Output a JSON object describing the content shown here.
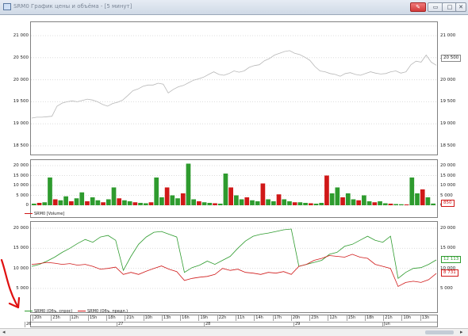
{
  "window": {
    "title": "SRM0 График цены и объёма - [5 минут]",
    "buttons": [
      "pin",
      "minimize",
      "maximize",
      "close"
    ]
  },
  "price_panel": {
    "y_ticks": [
      "21 000",
      "20 500",
      "20 000",
      "19 500",
      "19 000",
      "18 500"
    ],
    "last_tag": "20 500",
    "line_color": "#b8b8b8"
  },
  "volume_panel": {
    "y_ticks": [
      "20 000",
      "15 000",
      "10 000",
      "5 000",
      "0"
    ],
    "last_tag": "850",
    "legend": "SRM0 [Volume]",
    "colors": {
      "up": "#2e9b2e",
      "down": "#d01818"
    }
  },
  "orderbook_panel": {
    "y_ticks": [
      "20 000",
      "15 000",
      "10 000",
      "5 000"
    ],
    "tag_green": "12 113",
    "tag_red": "8 731",
    "legend_bid": "SRM0 (Объ. спрос)",
    "legend_ask": "SRM0 (Объ. предл.)",
    "colors": {
      "bid": "#2e9b2e",
      "ask": "#d01818"
    }
  },
  "x_axis": {
    "hours": [
      "20h",
      "23h",
      "12h",
      "15h",
      "18h",
      "21h",
      "10h",
      "13h",
      "16h",
      "19h",
      "22h",
      "11h",
      "14h",
      "17h",
      "20h",
      "23h",
      "12h",
      "15h",
      "18h",
      "21h",
      "10h",
      "13h"
    ],
    "days": [
      "26",
      "27",
      "28",
      "29",
      "Jun"
    ]
  },
  "annotation": {
    "arrow_color": "#e01010"
  },
  "chart_data": [
    {
      "type": "line",
      "title": "",
      "ylim": [
        18350,
        21150
      ],
      "series": [
        {
          "values": [
            19130,
            19150,
            19150,
            19160,
            19170,
            19400,
            19470,
            19500,
            19520,
            19500,
            19530,
            19560,
            19540,
            19500,
            19440,
            19400,
            19460,
            19490,
            19540,
            19640,
            19750,
            19790,
            19850,
            19880,
            19880,
            19920,
            19900,
            19700,
            19780,
            19840,
            19870,
            19930,
            19990,
            20020,
            20060,
            20120,
            20180,
            20120,
            20100,
            20140,
            20200,
            20170,
            20200,
            20280,
            20320,
            20340,
            20430,
            20480,
            20560,
            20600,
            20640,
            20660,
            20600,
            20570,
            20510,
            20440,
            20300,
            20200,
            20180,
            20140,
            20120,
            20080,
            20140,
            20160,
            20120,
            20100,
            20140,
            20180,
            20150,
            20130,
            20140,
            20180,
            20200,
            20150,
            20180,
            20340,
            20420,
            20400,
            20560,
            20400,
            20330
          ]
        }
      ]
    },
    {
      "type": "bar",
      "title": "",
      "ylim": [
        0,
        21000
      ],
      "series": [
        {
          "name": "SRM0 [Volume]",
          "values": [
            800,
            1200,
            1500,
            14000,
            3000,
            2500,
            4500,
            2000,
            3500,
            6500,
            2000,
            4000,
            2500,
            1500,
            3000,
            9000,
            3500,
            2500,
            2000,
            1500,
            1200,
            1000,
            1500,
            14000,
            4000,
            9000,
            5000,
            3500,
            6000,
            21000,
            3000,
            2000,
            1500,
            1200,
            1000,
            800,
            16000,
            9000,
            5000,
            3000,
            4000,
            2500,
            2000,
            11000,
            3000,
            2000,
            5500,
            3000,
            2000,
            1500,
            1500,
            1200,
            1000,
            800,
            1200,
            15000,
            6000,
            9000,
            4000,
            6000,
            3000,
            2500,
            5000,
            2000,
            1500,
            2000,
            1000,
            800,
            600,
            500,
            400,
            14000,
            6000,
            8000,
            4000,
            850
          ]
        }
      ]
    },
    {
      "type": "line",
      "title": "",
      "ylim": [
        2500,
        21500
      ],
      "series": [
        {
          "name": "SRM0 (Объ. спрос)",
          "values": [
            10500,
            11000,
            11800,
            12800,
            14000,
            15000,
            16200,
            17200,
            16500,
            17800,
            18200,
            17000,
            9500,
            13000,
            16000,
            17800,
            19000,
            19200,
            18500,
            17800,
            9000,
            10200,
            10800,
            11800,
            11000,
            12000,
            13000,
            15000,
            16800,
            18000,
            18500,
            18800,
            19200,
            19600,
            19800,
            10500,
            11000,
            11500,
            12000,
            13500,
            14000,
            15500,
            16000,
            17000,
            18000,
            17000,
            16500,
            18000,
            7500,
            9000,
            10000,
            10200,
            11000,
            12113
          ]
        },
        {
          "name": "SRM0 (Объ. предл.)",
          "values": [
            11000,
            11200,
            11500,
            11300,
            11000,
            11200,
            10800,
            11000,
            10500,
            9800,
            10000,
            10300,
            8500,
            9000,
            8500,
            9300,
            10000,
            10600,
            9800,
            9200,
            7000,
            7500,
            7800,
            8000,
            8500,
            10000,
            9500,
            9800,
            9000,
            8800,
            8500,
            9000,
            8800,
            9200,
            8500,
            10500,
            11000,
            12000,
            12500,
            13200,
            13000,
            12800,
            13500,
            12800,
            12500,
            11000,
            10500,
            10000,
            5500,
            6500,
            6800,
            6500,
            7200,
            8731
          ]
        }
      ]
    }
  ]
}
